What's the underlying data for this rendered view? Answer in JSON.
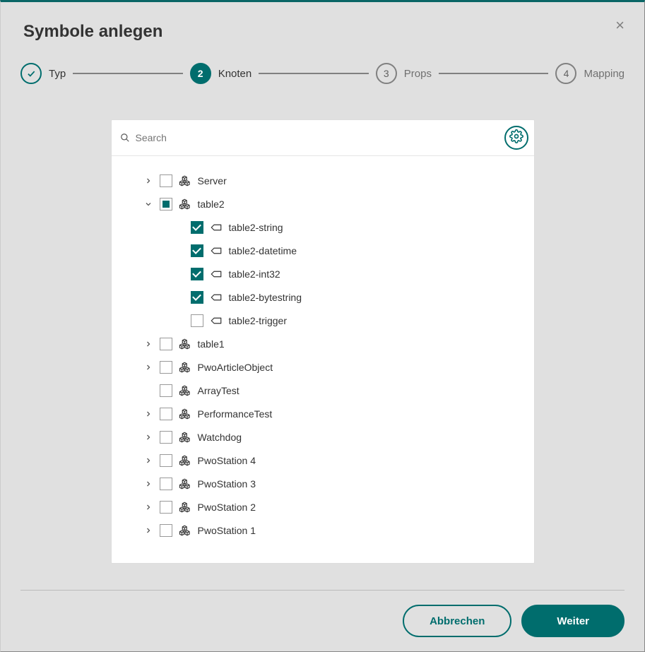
{
  "dialog": {
    "title": "Symbole anlegen"
  },
  "stepper": [
    {
      "label": "Typ",
      "state": "done"
    },
    {
      "label": "Knoten",
      "state": "active",
      "num": "2"
    },
    {
      "label": "Props",
      "state": "future",
      "num": "3"
    },
    {
      "label": "Mapping",
      "state": "future",
      "num": "4"
    }
  ],
  "search": {
    "placeholder": "Search"
  },
  "tree": {
    "nodes": [
      {
        "label": "Server",
        "level": 0,
        "expand": "right",
        "check": "unchecked",
        "icon": "object"
      },
      {
        "label": "table2",
        "level": 0,
        "expand": "down",
        "check": "indeterminate",
        "icon": "object"
      },
      {
        "label": "table2-string",
        "level": 1,
        "expand": "none",
        "check": "checked",
        "icon": "tag"
      },
      {
        "label": "table2-datetime",
        "level": 1,
        "expand": "none",
        "check": "checked",
        "icon": "tag"
      },
      {
        "label": "table2-int32",
        "level": 1,
        "expand": "none",
        "check": "checked",
        "icon": "tag"
      },
      {
        "label": "table2-bytestring",
        "level": 1,
        "expand": "none",
        "check": "checked",
        "icon": "tag"
      },
      {
        "label": "table2-trigger",
        "level": 1,
        "expand": "none",
        "check": "unchecked",
        "icon": "tag"
      },
      {
        "label": "table1",
        "level": 0,
        "expand": "right",
        "check": "unchecked",
        "icon": "object"
      },
      {
        "label": "PwoArticleObject",
        "level": 0,
        "expand": "right",
        "check": "unchecked",
        "icon": "object"
      },
      {
        "label": "ArrayTest",
        "level": 0,
        "expand": "none",
        "check": "unchecked",
        "icon": "object"
      },
      {
        "label": "PerformanceTest",
        "level": 0,
        "expand": "right",
        "check": "unchecked",
        "icon": "object"
      },
      {
        "label": "Watchdog",
        "level": 0,
        "expand": "right",
        "check": "unchecked",
        "icon": "object"
      },
      {
        "label": "PwoStation 4",
        "level": 0,
        "expand": "right",
        "check": "unchecked",
        "icon": "object"
      },
      {
        "label": "PwoStation 3",
        "level": 0,
        "expand": "right",
        "check": "unchecked",
        "icon": "object"
      },
      {
        "label": "PwoStation 2",
        "level": 0,
        "expand": "right",
        "check": "unchecked",
        "icon": "object"
      },
      {
        "label": "PwoStation 1",
        "level": 0,
        "expand": "right",
        "check": "unchecked",
        "icon": "object"
      }
    ]
  },
  "buttons": {
    "cancel": "Abbrechen",
    "next": "Weiter"
  }
}
